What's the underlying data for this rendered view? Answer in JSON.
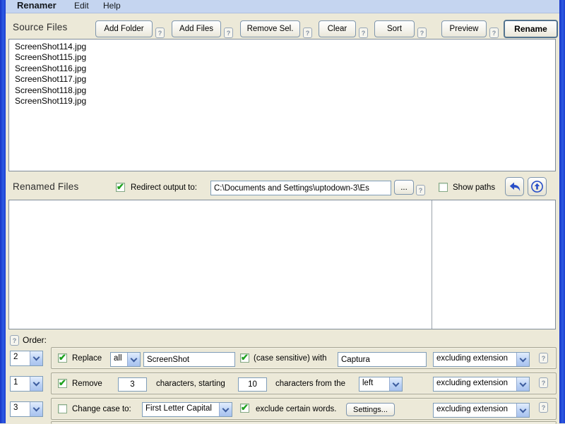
{
  "menu": {
    "items": [
      "Renamer",
      "Edit",
      "Help"
    ]
  },
  "help_glyph": "?",
  "source": {
    "title": "Source Files",
    "buttons": [
      "Add Folder",
      "Add Files",
      "Remove Sel.",
      "Clear",
      "Sort",
      "Preview",
      "Rename"
    ],
    "files": [
      "ScreenShot114.jpg",
      "ScreenShot115.jpg",
      "ScreenShot116.jpg",
      "ScreenShot117.jpg",
      "ScreenShot118.jpg",
      "ScreenShot119.jpg"
    ]
  },
  "renamed": {
    "title": "Renamed Files",
    "redirect_label": "Redirect output to:",
    "redirect_checked": true,
    "path": "C:\\Documents and Settings\\uptodown-3\\Es",
    "browse_label": "...",
    "show_paths_label": "Show paths",
    "show_paths_checked": false
  },
  "order": {
    "label": "Order:",
    "rules": [
      {
        "index": "2",
        "enabled": true,
        "action": "Replace",
        "scope": "all",
        "find": "ScreenShot",
        "case_checked": true,
        "case_label": "(case sensitive)  with",
        "replace_with": "Captura",
        "apply_to": "excluding extension"
      },
      {
        "index": "1",
        "enabled": true,
        "action": "Remove",
        "count": "3",
        "mid1": "characters, starting",
        "start": "10",
        "mid2": "characters from the",
        "side": "left",
        "apply_to": "excluding extension"
      },
      {
        "index": "3",
        "enabled": false,
        "action": "Change case to:",
        "mode": "First Letter Capital",
        "exclude_checked": true,
        "exclude_label": "exclude certain words.",
        "settings_label": "Settings...",
        "apply_to": "excluding extension"
      }
    ]
  },
  "colors": {
    "window_border_blue": "#2248d4",
    "menu_bar_blue": "#c5d5f0",
    "client_beige": "#ece9d8",
    "check_green": "#1ea21e",
    "icon_arrow_blue": "#2a50c8"
  }
}
